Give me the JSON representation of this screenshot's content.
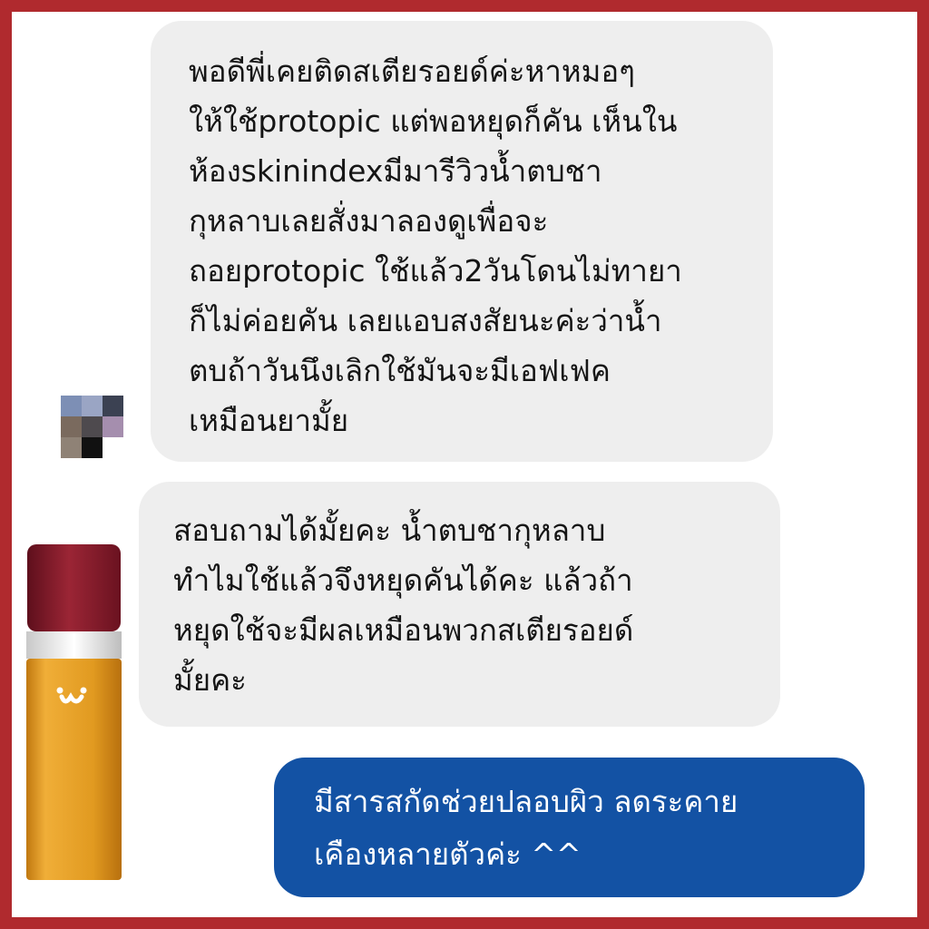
{
  "chat": {
    "messages": [
      {
        "sender": "customer",
        "text": "พอดีพี่เคยติดสเตียรอยด์ค่ะหาหมอๆ\nให้ใช้protopic แต่พอหยุดก็คัน เห็นใน\nห้องskinindexมีมารีวิวน้ำตบชา\nกุหลาบเลยสั่งมาลองดูเพื่อจะ\nถอยprotopic ใช้แล้ว2วันโดนไม่ทายา\nก็ไม่ค่อยคัน เลยแอบสงสัยนะค่ะว่าน้ำ\nตบถ้าวันนึงเลิกใช้มันจะมีเอฟเฟค\nเหมือนยามั้ย"
      },
      {
        "sender": "customer",
        "text": "สอบถามได้มั้ยคะ น้ำตบชากุหลาบ\nทำไมใช้แล้วจึงหยุดคันได้คะ แล้วถ้า\nหยุดใช้จะมีผลเหมือนพวกสเตียรอยด์\nมั้ยคะ"
      },
      {
        "sender": "shop",
        "text": "มีสารสกัดช่วยปลอบผิว ลดระคาย\nเคืองหลายตัวค่ะ ^^"
      }
    ]
  },
  "colors": {
    "frame_border": "#b02a2e",
    "incoming_bubble": "#eeeeee",
    "outgoing_bubble": "#1352a4",
    "bottle_cap": "#8e1f2c",
    "bottle_body": "#e19a20"
  },
  "icons": {
    "avatar": "pixelated-avatar-icon",
    "product": "toner-bottle-icon"
  }
}
